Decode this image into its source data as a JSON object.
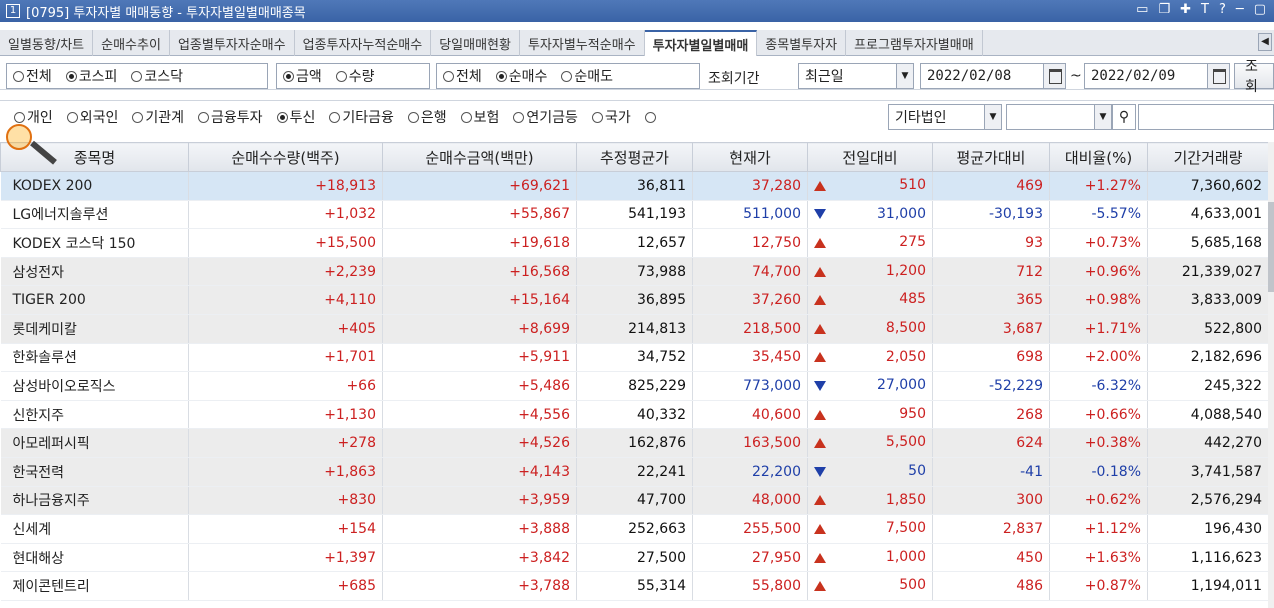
{
  "window": {
    "num": "1",
    "title": "[0795] 투자자별 매매동향 - 투자자별일별매매종목"
  },
  "tabs": [
    "일별동향/차트",
    "순매수추이",
    "업종별투자자순매수",
    "업종투자자누적순매수",
    "당일매매현황",
    "투자자별누적순매수",
    "투자자별일별매매",
    "종목별투자자",
    "프로그램투자자별매매"
  ],
  "active_tab": "투자자별일별매매",
  "filters": {
    "market": {
      "options": [
        "전체",
        "코스피",
        "코스닥"
      ],
      "selected": "코스피"
    },
    "unit": {
      "options": [
        "금액",
        "수량"
      ],
      "selected": "금액"
    },
    "trade": {
      "options": [
        "전체",
        "순매수",
        "순매도"
      ],
      "selected": "순매수"
    },
    "period_label": "조회기간",
    "period_value": "최근일",
    "date_from": "2022/02/08",
    "date_sep": "~",
    "date_to": "2022/02/09",
    "query_button": "조회",
    "investors": {
      "options": [
        "개인",
        "외국인",
        "기관계",
        "금융투자",
        "투신",
        "기타금융",
        "은행",
        "보험",
        "연기금등",
        "국가"
      ],
      "selected": "투신"
    },
    "other_select": "기타법인"
  },
  "table": {
    "headers": [
      "종목명",
      "순매수수량(백주)",
      "순매수금액(백만)",
      "추정평균가",
      "현재가",
      "전일대비",
      "평균가대비",
      "대비율(%)",
      "기간거래량"
    ],
    "rows": [
      {
        "name": "KODEX 200",
        "qty": "+18,913",
        "amt": "+69,621",
        "avg": "36,811",
        "price": "37,280",
        "dir": "up",
        "chg": "510",
        "avgdiff": "469",
        "rate": "+1.27%",
        "vol": "7,360,602"
      },
      {
        "name": "LG에너지솔루션",
        "qty": "+1,032",
        "amt": "+55,867",
        "avg": "541,193",
        "price": "511,000",
        "dir": "down",
        "chg": "31,000",
        "avgdiff": "-30,193",
        "rate": "-5.57%",
        "vol": "4,633,001"
      },
      {
        "name": "KODEX 코스닥 150",
        "qty": "+15,500",
        "amt": "+19,618",
        "avg": "12,657",
        "price": "12,750",
        "dir": "up",
        "chg": "275",
        "avgdiff": "93",
        "rate": "+0.73%",
        "vol": "5,685,168"
      },
      {
        "name": "삼성전자",
        "qty": "+2,239",
        "amt": "+16,568",
        "avg": "73,988",
        "price": "74,700",
        "dir": "up",
        "chg": "1,200",
        "avgdiff": "712",
        "rate": "+0.96%",
        "vol": "21,339,027"
      },
      {
        "name": "TIGER 200",
        "qty": "+4,110",
        "amt": "+15,164",
        "avg": "36,895",
        "price": "37,260",
        "dir": "up",
        "chg": "485",
        "avgdiff": "365",
        "rate": "+0.98%",
        "vol": "3,833,009"
      },
      {
        "name": "롯데케미칼",
        "qty": "+405",
        "amt": "+8,699",
        "avg": "214,813",
        "price": "218,500",
        "dir": "up",
        "chg": "8,500",
        "avgdiff": "3,687",
        "rate": "+1.71%",
        "vol": "522,800"
      },
      {
        "name": "한화솔루션",
        "qty": "+1,701",
        "amt": "+5,911",
        "avg": "34,752",
        "price": "35,450",
        "dir": "up",
        "chg": "2,050",
        "avgdiff": "698",
        "rate": "+2.00%",
        "vol": "2,182,696"
      },
      {
        "name": "삼성바이오로직스",
        "qty": "+66",
        "amt": "+5,486",
        "avg": "825,229",
        "price": "773,000",
        "dir": "down",
        "chg": "27,000",
        "avgdiff": "-52,229",
        "rate": "-6.32%",
        "vol": "245,322"
      },
      {
        "name": "신한지주",
        "qty": "+1,130",
        "amt": "+4,556",
        "avg": "40,332",
        "price": "40,600",
        "dir": "up",
        "chg": "950",
        "avgdiff": "268",
        "rate": "+0.66%",
        "vol": "4,088,540"
      },
      {
        "name": "아모레퍼시픽",
        "qty": "+278",
        "amt": "+4,526",
        "avg": "162,876",
        "price": "163,500",
        "dir": "up",
        "chg": "5,500",
        "avgdiff": "624",
        "rate": "+0.38%",
        "vol": "442,270"
      },
      {
        "name": "한국전력",
        "qty": "+1,863",
        "amt": "+4,143",
        "avg": "22,241",
        "price": "22,200",
        "dir": "down",
        "chg": "50",
        "avgdiff": "-41",
        "rate": "-0.18%",
        "vol": "3,741,587"
      },
      {
        "name": "하나금융지주",
        "qty": "+830",
        "amt": "+3,959",
        "avg": "47,700",
        "price": "48,000",
        "dir": "up",
        "chg": "1,850",
        "avgdiff": "300",
        "rate": "+0.62%",
        "vol": "2,576,294"
      },
      {
        "name": "신세계",
        "qty": "+154",
        "amt": "+3,888",
        "avg": "252,663",
        "price": "255,500",
        "dir": "up",
        "chg": "7,500",
        "avgdiff": "2,837",
        "rate": "+1.12%",
        "vol": "196,430"
      },
      {
        "name": "현대해상",
        "qty": "+1,397",
        "amt": "+3,842",
        "avg": "27,500",
        "price": "27,950",
        "dir": "up",
        "chg": "1,000",
        "avgdiff": "450",
        "rate": "+1.63%",
        "vol": "1,116,623"
      },
      {
        "name": "제이콘텐트리",
        "qty": "+685",
        "amt": "+3,788",
        "avg": "55,314",
        "price": "55,800",
        "dir": "up",
        "chg": "500",
        "avgdiff": "486",
        "rate": "+0.87%",
        "vol": "1,194,011"
      }
    ]
  },
  "colors": {
    "up": "#cc2020",
    "down": "#1f3fa8",
    "highlight_row": "#d6e6f5",
    "group_row": "#ececec"
  }
}
